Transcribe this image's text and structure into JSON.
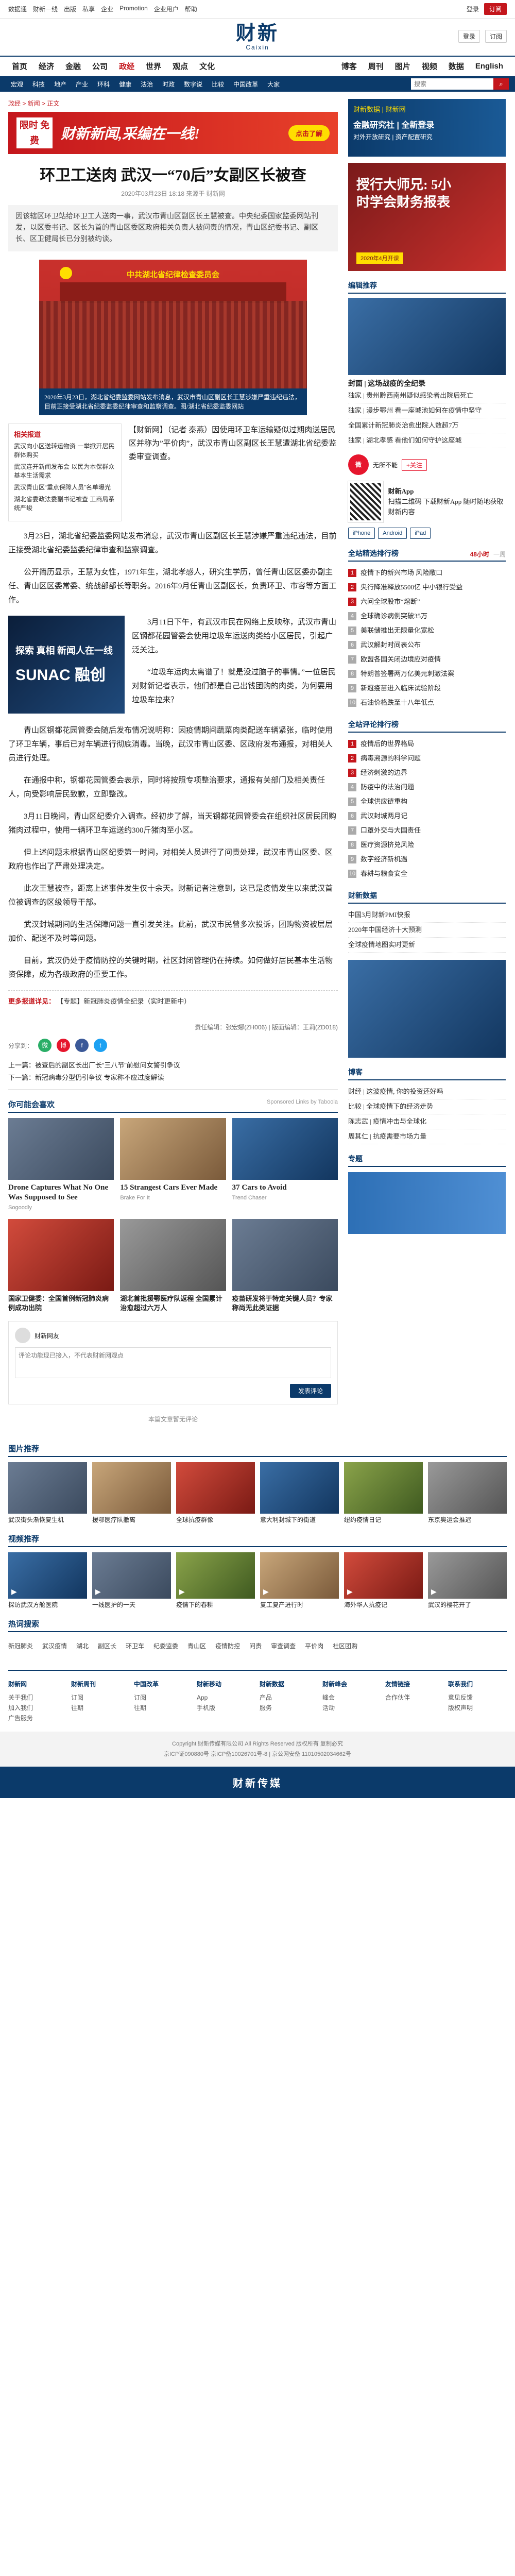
{
  "topbar": {
    "links": [
      "数据通",
      "财新一线",
      "出版",
      "私享",
      "企业",
      "Promotion",
      "企业用户",
      "帮助"
    ],
    "login": "登录",
    "subscribe": "订阅"
  },
  "masthead": {
    "logo_cn": "财新",
    "logo_en": "Caixin",
    "tools": [
      "登录",
      "订阅"
    ]
  },
  "nav": {
    "items": [
      "首页",
      "经济",
      "金融",
      "公司",
      "政经",
      "世界",
      "观点",
      "文化",
      "博客",
      "周刊",
      "图片",
      "视频",
      "数据",
      "English"
    ],
    "active_index": 4
  },
  "subnav": {
    "items": [
      "宏观",
      "科技",
      "地产",
      "产业",
      "环科",
      "健康",
      "法治",
      "时政",
      "数字说",
      "比较",
      "中国改革",
      "大家"
    ],
    "search_placeholder": "搜索"
  },
  "breadcrumb": "政经 > 新闻 > 正文",
  "top_ad": {
    "badge": "限时 免费",
    "text": "财新新闻,采编在一线!",
    "button": "点击了解"
  },
  "article": {
    "title": "环卫工送肉 武汉一“70后”女副区长被查",
    "meta": "2020年03月23日 18:18 来源于 财新网",
    "summary": "因该辖区环卫站给环卫工人送肉一事，武汉市青山区副区长王慧被查。中央纪委国家监委网站刊发，以区委书记、区长为首的青山区委区政府相关负责人被问责的情况，青山区纪委书记、副区长、区卫健局长已分别被约谈。",
    "figure_header": "中共湖北省纪律检查委员会",
    "figure_caption": "2020年3月23日，湖北省纪委监委网站发布消息，武汉市青山区副区长王慧涉嫌严重违纪违法，目前正接受湖北省纪委监委纪律审查和监察调查。图/湖北省纪委监委网站",
    "lead_box_title": "相关报道",
    "lead_box_items": [
      "武汉向小区送转运物资 一举掀开居民群体购买",
      "武汉连开新闻发布会 以民为本保群众基本生活需求",
      "武汉青山区“重点保障人员”名单曝光",
      "湖北省委政法委副书记被查 工商局系统严峻"
    ],
    "lead_text": "【财新网】（记者 秦燕）因使用环卫车运输疑似过期肉送居民区并称为”平价肉”，武汉市青山区副区长王慧遭湖北省纪委监委审查调查。",
    "paragraphs": [
      "3月23日，湖北省纪委监委网站发布消息，武汉市青山区副区长王慧涉嫌严重违纪违法，目前正接受湖北省纪委监委纪律审查和监察调查。",
      "公开简历显示，王慧为女性，1971年生，湖北孝感人，研究生学历，曾任青山区区委办副主任、青山区区委常委、统战部部长等职务。2016年9月任青山区副区长，负责环卫、市容等方面工作。",
      "3月11日下午，有武汉市民在网络上反映称，武汉市青山区钢都花园管委会使用垃圾车运送肉类给小区居民，引起广泛关注。",
      "“垃圾车运肉太离谱了！就是没过脑子的事情。”一位居民对财新记者表示，他们都是自己出钱团购的肉类，为何要用垃圾车拉来？",
      "青山区钢都花园管委会随后发布情况说明称：因疫情期间蔬菜肉类配送车辆紧张，临时使用了环卫车辆，事后已对车辆进行彻底消毒。当晚，武汉市青山区委、区政府发布通报，对相关人员进行处理。",
      "在通报中称，钢都花园管委会表示，同时将按照专项整治要求，通报有关部门及相关责任人，向受影响居民致歉，立即整改。",
      "3月11日晚间，青山区纪委介入调查。经初步了解，当天钢都花园管委会在组织社区居民团购猪肉过程中，使用一辆环卫车运送约300斤猪肉至小区。",
      "但上述问题未根据青山区纪委第一时间，对相关人员进行了问责处理，武汉市青山区委、区政府也作出了严肃处理决定。",
      "此次王慧被查，距离上述事件发生仅十余天。财新记者注意到，这已是疫情发生以来武汉首位被调查的区级领导干部。",
      "武汉封城期间的生活保障问题一直引发关注。此前，武汉市民曾多次投诉，团购物资被层层加价、配送不及时等问题。",
      "目前，武汉仍处于疫情防控的关键时期，社区封闭管理仍在持续。如何做好居民基本生活物资保障，成为各级政府的重要工作。"
    ],
    "inline_ad": {
      "line1": "探索 真相 新闻人在一线",
      "line2": "SUNAC 融创"
    },
    "editor": "责任编辑：张宏娜(ZH006) | 版面编辑：王莉(ZD018)",
    "notice_bold": "更多报道详见：",
    "notice_text": "【专题】新冠肺炎疫情全纪录（实时更新中）",
    "share_label": "分享到：",
    "prev": "上一篇：被查后的副区长出厂长“三八节”前慰问女警引争议",
    "next": "下一篇：新冠病毒分型仍引争议 专家称不应过度解读"
  },
  "sponsored": {
    "title": "你可能会喜欢",
    "by": "Sponsored Links by Taboola",
    "cards": [
      {
        "title": "Drone Captures What No One Was Supposed to See",
        "source": "Sogoodly"
      },
      {
        "title": "15 Strangest Cars Ever Made",
        "source": "Brake For It"
      },
      {
        "title": "37 Cars to Avoid",
        "source": "Trend Chaser"
      }
    ]
  },
  "related": [
    {
      "title": "国家卫健委：全国首例新冠肺炎病例成功出院"
    },
    {
      "title": "湖北首批援鄂医疗队返程 全国累计治愈超过六万人"
    },
    {
      "title": "疫苗研发将于特定关键人员？专家称尚无此类证据"
    }
  ],
  "comment": {
    "header": "财新网友",
    "placeholder": "评论功能现已接入，不代表财新网观点",
    "submit": "发表评论",
    "empty": "本篇文章暂无评论"
  },
  "sidebar": {
    "ad1": {
      "top": "财新数据 | 财新网",
      "line1": "金融研究社 | 全新登录",
      "line2": "对外开放研究 | 资产配置研究"
    },
    "ad2": {
      "line1": "授行大师兄: 5小",
      "line2": "时学会财务报表",
      "date": "2020年4月开课"
    },
    "editor_pick": "编辑推荐",
    "pick_title": "封面 | 这场战疫的全纪录",
    "pick_list": [
      "独家 | 贵州黔西南州疑似感染者出院后死亡",
      "独家 | 漫步鄂州 看一座城池如何在疫情中坚守",
      "全国累计新冠肺炎治愈出院人数超7万",
      "独家 | 湖北孝感 看他们如何守护这座城"
    ],
    "weibo_name": "无所不能",
    "weibo_follow": "+关注",
    "app_title": "财新App",
    "app_desc": "扫描二维码 下载财新App 随时随地获取财新内容",
    "app_btns": [
      "iPhone",
      "Android",
      "iPad"
    ],
    "rank_title": "全站精选排行榜",
    "rank_tabs": [
      "48小时",
      "一周"
    ],
    "rank": [
      "疫情下的新兴市场 风险敞口",
      "央行降准释放5500亿 中小银行受益",
      "六问全球股市“熔断”",
      "全球确诊病例突破35万",
      "美联储推出无限量化宽松",
      "武汉解封时间表公布",
      "欧盟各国关闭边境应对疫情",
      "特朗普签署两万亿美元刺激法案",
      "新冠疫苗进入临床试验阶段",
      "石油价格跌至十八年低点"
    ],
    "blog_rank_title": "全站评论排行榜",
    "blog_rank": [
      "疫情后的世界格局",
      "病毒溯源的科学问题",
      "经济刺激的边界",
      "防疫中的法治问题",
      "全球供应链重构",
      "武汉封城两月记",
      "口罩外交与大国责任",
      "医疗资源挤兑风险",
      "数字经济新机遇",
      "春耕与粮食安全"
    ],
    "data_title": "财新数据",
    "data_list": [
      "中国3月财新PMI快报",
      "2020年中国经济十大预测",
      "全球疫情地图实时更新"
    ],
    "blog_title": "博客",
    "blog_list": [
      "财经 | 这波疫情, 你的投资还好吗",
      "比较 | 全球疫情下的经济走势",
      "陈志武 | 疫情冲击与全球化",
      "周其仁 | 抗疫需要市场力量"
    ],
    "special_title": "专题"
  },
  "pictures": {
    "title": "图片推荐",
    "items": [
      "武汉街头渐恢复生机",
      "援鄂医疗队撤离",
      "全球抗疫群像",
      "意大利封城下的街道",
      "纽约疫情日记",
      "东京奥运会推迟"
    ]
  },
  "videos": {
    "title": "视频推荐",
    "items": [
      "探访武汉方舱医院",
      "一线医护的一天",
      "疫情下的春耕",
      "复工复产进行时",
      "海外华人抗疫记",
      "武汉的樱花开了"
    ]
  },
  "hot": {
    "title": "热词搜索",
    "items": [
      "新冠肺炎",
      "武汉疫情",
      "湖北",
      "副区长",
      "环卫车",
      "纪委监委",
      "青山区",
      "疫情防控",
      "问责",
      "审查调查",
      "平价肉",
      "社区团购"
    ]
  },
  "footer": {
    "cols": [
      {
        "h": "财新网",
        "items": [
          "关于我们",
          "加入我们",
          "广告服务"
        ]
      },
      {
        "h": "财新周刊",
        "items": [
          "订阅",
          "往期"
        ]
      },
      {
        "h": "中国改革",
        "items": [
          "订阅",
          "往期"
        ]
      },
      {
        "h": "财新移动",
        "items": [
          "App",
          "手机版"
        ]
      },
      {
        "h": "财新数据",
        "items": [
          "产品",
          "服务"
        ]
      },
      {
        "h": "财新峰会",
        "items": [
          "峰会",
          "活动"
        ]
      },
      {
        "h": "友情链接",
        "items": [
          "合作伙伴"
        ]
      },
      {
        "h": "联系我们",
        "items": [
          "意见反馈",
          "版权声明"
        ]
      }
    ],
    "copyright": "Copyright 财新传媒有限公司 All Rights Reserved 版权所有 复制必究",
    "icp": "京ICP证090880号 京ICP备10026701号-8 | 京公网安备 11010502034662号",
    "bottom_logo": "财新传媒"
  }
}
